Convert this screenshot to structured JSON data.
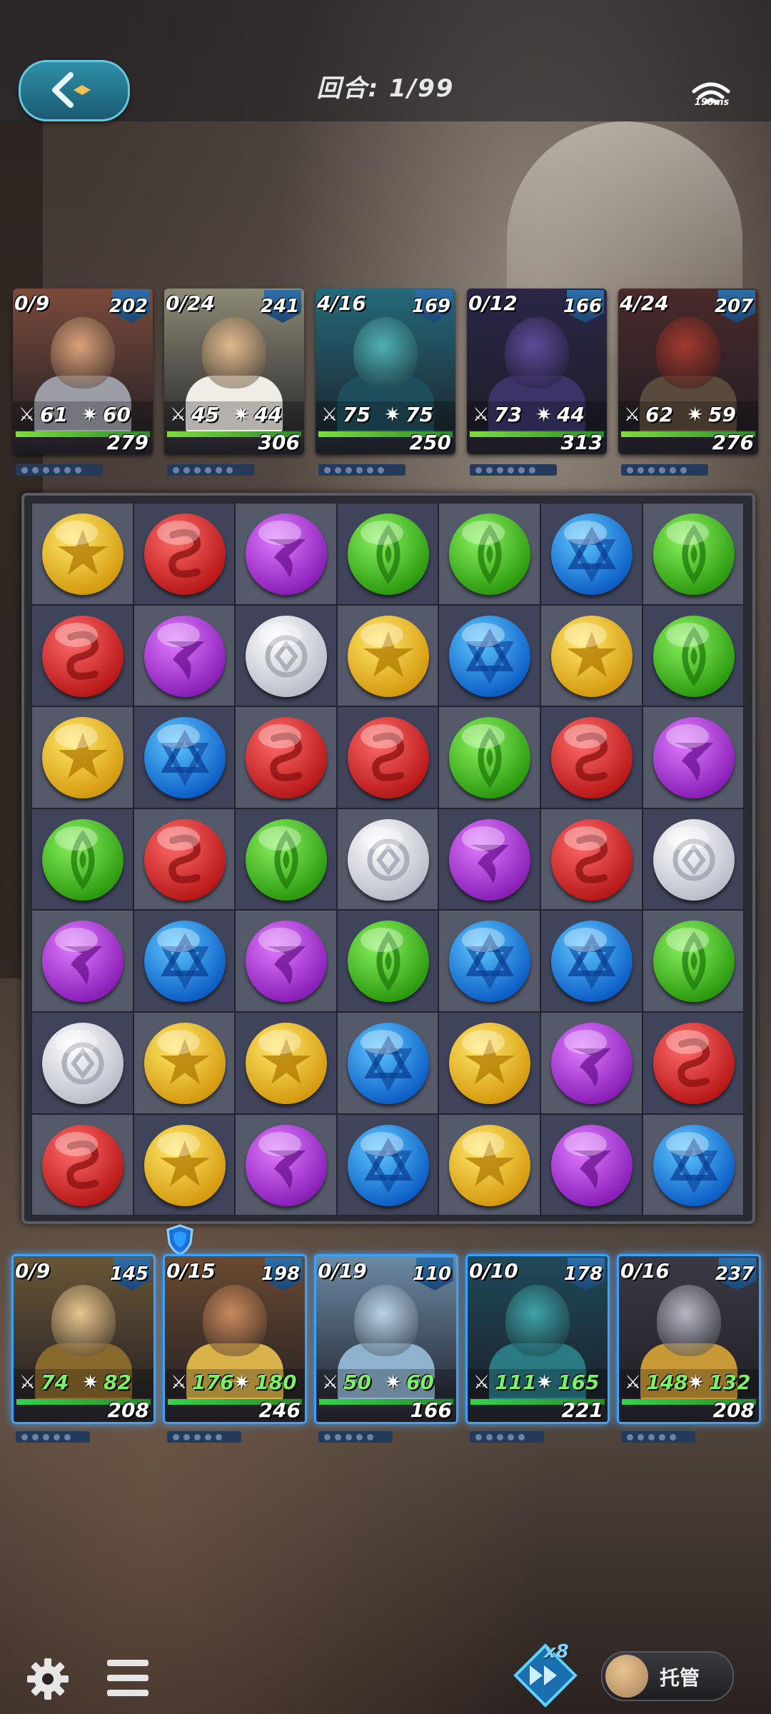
{
  "header": {
    "round_label": "回合: 1/99",
    "ping": "198ms",
    "back_icon": "back-arrow-icon",
    "wifi_icon": "wifi-icon"
  },
  "enemies": [
    {
      "energy": "0/9",
      "hp": "202",
      "atk": "61",
      "def": "60",
      "total": "279",
      "theme": "#7a4b3a",
      "head": "#d9a27c",
      "body": "#9d9da8",
      "bar": "#7fdc3f"
    },
    {
      "energy": "0/24",
      "hp": "241",
      "atk": "45",
      "def": "44",
      "total": "306",
      "theme": "#8d8a74",
      "head": "#e1b98c",
      "body": "#f0ede6",
      "bar": "#7fdc3f"
    },
    {
      "energy": "4/16",
      "hp": "169",
      "atk": "75",
      "def": "75",
      "total": "250",
      "theme": "#246a7a",
      "head": "#4fb0b3",
      "body": "#1f4e5d",
      "bar": "#7fdc3f"
    },
    {
      "energy": "0/12",
      "hp": "166",
      "atk": "73",
      "def": "44",
      "total": "313",
      "theme": "#2a2647",
      "head": "#5f4b9a",
      "body": "#3b3468",
      "bar": "#7fdc3f"
    },
    {
      "energy": "4/24",
      "hp": "207",
      "atk": "62",
      "def": "59",
      "total": "276",
      "theme": "#4b2a2a",
      "head": "#a23a30",
      "body": "#5a4a3e",
      "bar": "#7fdc3f"
    }
  ],
  "board": [
    [
      "yellow",
      "red",
      "purple",
      "green",
      "green",
      "blue",
      "green"
    ],
    [
      "red",
      "purple",
      "white",
      "yellow",
      "blue",
      "yellow",
      "green"
    ],
    [
      "yellow",
      "blue",
      "red",
      "red",
      "green",
      "red",
      "purple"
    ],
    [
      "green",
      "red",
      "green",
      "white",
      "purple",
      "red",
      "white"
    ],
    [
      "purple",
      "blue",
      "purple",
      "green",
      "blue",
      "blue",
      "green"
    ],
    [
      "white",
      "yellow",
      "yellow",
      "blue",
      "yellow",
      "purple",
      "red"
    ],
    [
      "red",
      "yellow",
      "purple",
      "blue",
      "yellow",
      "purple",
      "blue"
    ]
  ],
  "orb_colors": {
    "yellow": {
      "a": "#ffe86a",
      "b": "#d59a0e",
      "g": "#b07800"
    },
    "red": {
      "a": "#ff6a6a",
      "b": "#b81818",
      "g": "#8a1010"
    },
    "purple": {
      "a": "#e07cff",
      "b": "#8a1fb8",
      "g": "#6a108e"
    },
    "green": {
      "a": "#8af25e",
      "b": "#2c9a10",
      "g": "#1f7a0a"
    },
    "blue": {
      "a": "#5ec8ff",
      "b": "#0d5ec6",
      "g": "#0a3f94"
    },
    "white": {
      "a": "#ffffff",
      "b": "#b9bec8",
      "g": "#9aa0ac"
    }
  },
  "team": [
    {
      "energy": "0/9",
      "hp": "145",
      "atk": "74",
      "def": "82",
      "total": "208",
      "theme": "#6a5636",
      "head": "#e8c58d",
      "body": "#8a6a2c",
      "bar": "#36d24a"
    },
    {
      "energy": "0/15",
      "hp": "198",
      "atk": "176",
      "def": "180",
      "total": "246",
      "theme": "#6a4a30",
      "head": "#c98a5e",
      "body": "#d9b24a",
      "bar": "#36d24a"
    },
    {
      "energy": "0/19",
      "hp": "110",
      "atk": "50",
      "def": "60",
      "total": "166",
      "theme": "#6c8aa3",
      "head": "#b7d2e6",
      "body": "#8fb3cf",
      "bar": "#36d24a"
    },
    {
      "energy": "0/10",
      "hp": "178",
      "atk": "111",
      "def": "165",
      "total": "221",
      "theme": "#1f4a5a",
      "head": "#3fa3a8",
      "body": "#2a7a84",
      "bar": "#36d24a"
    },
    {
      "energy": "0/16",
      "hp": "237",
      "atk": "148",
      "def": "132",
      "total": "208",
      "theme": "#3b3a44",
      "head": "#b7b7c4",
      "body": "#c89a36",
      "bar": "#36d24a"
    }
  ],
  "controls": {
    "speed_label": "x8",
    "auto_label": "托管",
    "settings_icon": "gear-icon",
    "menu_icon": "hamburger-menu-icon",
    "speed_icon": "fast-forward-icon",
    "team_buff_icon": "shield-icon"
  }
}
